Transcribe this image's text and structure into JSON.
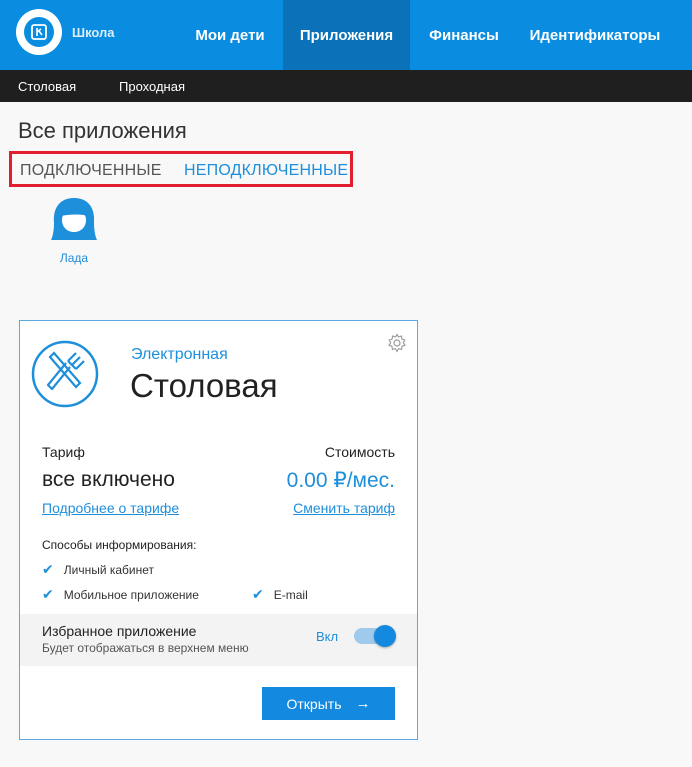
{
  "header": {
    "logo_text": "Школа",
    "nav": [
      {
        "label": "Мои дети",
        "active": false
      },
      {
        "label": "Приложения",
        "active": true
      },
      {
        "label": "Финансы",
        "active": false
      },
      {
        "label": "Идентификаторы",
        "active": false
      }
    ]
  },
  "subnav": {
    "items": [
      {
        "label": "Столовая"
      },
      {
        "label": "Проходная"
      }
    ]
  },
  "page": {
    "title": "Все приложения",
    "tabs": {
      "connected": "ПОДКЛЮЧЕННЫЕ",
      "disconnected": "НЕПОДКЛЮЧЕННЫЕ"
    },
    "child": {
      "name": "Лада",
      "icon": "child-avatar-icon"
    }
  },
  "card": {
    "subtitle": "Электронная",
    "title": "Столовая",
    "icon": "fork-knife-icon",
    "settings_icon": "gear-icon",
    "tariff_label": "Тариф",
    "cost_label": "Стоимость",
    "tariff_value": "все включено",
    "cost_value": "0.00 ₽/мес.",
    "tariff_link": "Подробнее о тарифе",
    "change_link": "Сменить тариф",
    "notify_title": "Способы информирования:",
    "notify_items": [
      {
        "label": "Личный кабинет"
      },
      {
        "label": "Мобильное приложение"
      },
      {
        "label": "E-mail"
      }
    ],
    "favorite": {
      "title": "Избранное приложение",
      "subtitle": "Будет отображаться в верхнем меню",
      "state_label": "Вкл",
      "enabled": true
    },
    "open_button": "Открыть",
    "open_arrow": "→"
  },
  "colors": {
    "nav_bg": "#0a8de0",
    "nav_active": "#0b72b9",
    "accent": "#1e8fdb",
    "highlight_border": "#e21f2e"
  }
}
